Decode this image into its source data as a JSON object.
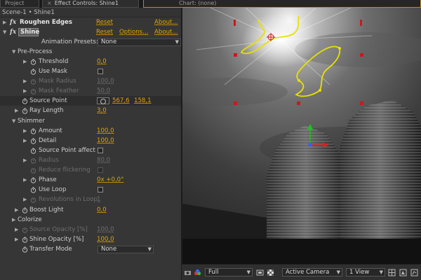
{
  "tabs": {
    "project": "Project",
    "effect_controls": "Effect Controls: Shine1",
    "composition_title": "Chart: (none)"
  },
  "breadcrumb": "Scene-1 • Shine1",
  "effects": [
    {
      "name": "Roughen Edges",
      "reset": "Reset",
      "about": "About..."
    },
    {
      "name": "Shine",
      "reset": "Reset",
      "options": "Options...",
      "about": "About..."
    }
  ],
  "animation_presets": {
    "label": "Animation Presets:",
    "value": "None"
  },
  "pre_process": {
    "label": "Pre-Process",
    "threshold": {
      "label": "Threshold",
      "value": "0,0"
    },
    "use_mask": {
      "label": "Use Mask"
    },
    "mask_radius": {
      "label": "Mask Radius",
      "value": "100,0"
    },
    "mask_feather": {
      "label": "Mask Feather",
      "value": "50,0"
    }
  },
  "source_point": {
    "label": "Source Point",
    "x": "567,6",
    "y": "158,1"
  },
  "ray_length": {
    "label": "Ray Length",
    "value": "3,0"
  },
  "shimmer": {
    "label": "Shimmer",
    "amount": {
      "label": "Amount",
      "value": "100,0"
    },
    "detail": {
      "label": "Detail",
      "value": "100,0"
    },
    "source_point_affect": {
      "label": "Source Point affect"
    },
    "radius": {
      "label": "Radius",
      "value": "80,0"
    },
    "reduce_flickering": {
      "label": "Reduce flickering"
    },
    "phase": {
      "label": "Phase",
      "value": "0x +0,0°"
    },
    "use_loop": {
      "label": "Use Loop"
    },
    "revolutions": {
      "label": "Revolutions in Loop",
      "value": "1"
    }
  },
  "boost_light": {
    "label": "Boost Light",
    "value": "0,0"
  },
  "colorize": {
    "label": "Colorize"
  },
  "source_opacity": {
    "label": "Source Opacity [%]",
    "value": "100,0"
  },
  "shine_opacity": {
    "label": "Shine Opacity [%]",
    "value": "100,0"
  },
  "transfer_mode": {
    "label": "Transfer Mode",
    "value": "None"
  },
  "toolbar": {
    "resolution": "Full",
    "camera": "Active Camera",
    "view": "1 View"
  },
  "colors": {
    "accent": "#e3a400",
    "panel": "#363636",
    "mask_path": "#e8e000"
  }
}
